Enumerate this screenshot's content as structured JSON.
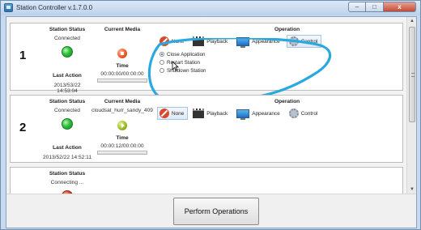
{
  "window": {
    "title": "Station Controller v.1.7.0.0",
    "buttons": {
      "minimize": "–",
      "maximize": "□",
      "close": "x"
    }
  },
  "labels": {
    "station_status": "Station Status",
    "current_media": "Current Media",
    "time": "Time",
    "last_action": "Last Action",
    "operation": "Operation"
  },
  "stations": [
    {
      "number": "1",
      "status": "Connected",
      "status_color": "green",
      "media": "",
      "media_state": "stopped",
      "time": "00:00:00/00:00:00",
      "last_action": "2013/53/22 14:53:04",
      "selected_tab": "Control"
    },
    {
      "number": "2",
      "status": "Connected",
      "status_color": "green",
      "media": "cloudsat_hurr_sandy_409",
      "media_state": "playing",
      "time": "00:00:12/00:00:00",
      "last_action": "2013/52/22 14:52:11",
      "selected_tab": "None"
    },
    {
      "number": "3",
      "status": "Connecting ...",
      "status_color": "red"
    }
  ],
  "operation_tabs": [
    {
      "label": "None",
      "icon": "none-icon"
    },
    {
      "label": "Playback",
      "icon": "clapperboard-icon"
    },
    {
      "label": "Appearance",
      "icon": "monitor-icon"
    },
    {
      "label": "Control",
      "icon": "gear-icon"
    }
  ],
  "control_options": [
    {
      "label": "Close Application",
      "checked": true
    },
    {
      "label": "Restart Station",
      "checked": false
    },
    {
      "label": "Shutdown Station",
      "checked": false
    }
  ],
  "perform_button": "Perform Operations",
  "colors": {
    "annotation": "#2aa8e0",
    "accent": "#a9c3e3"
  }
}
